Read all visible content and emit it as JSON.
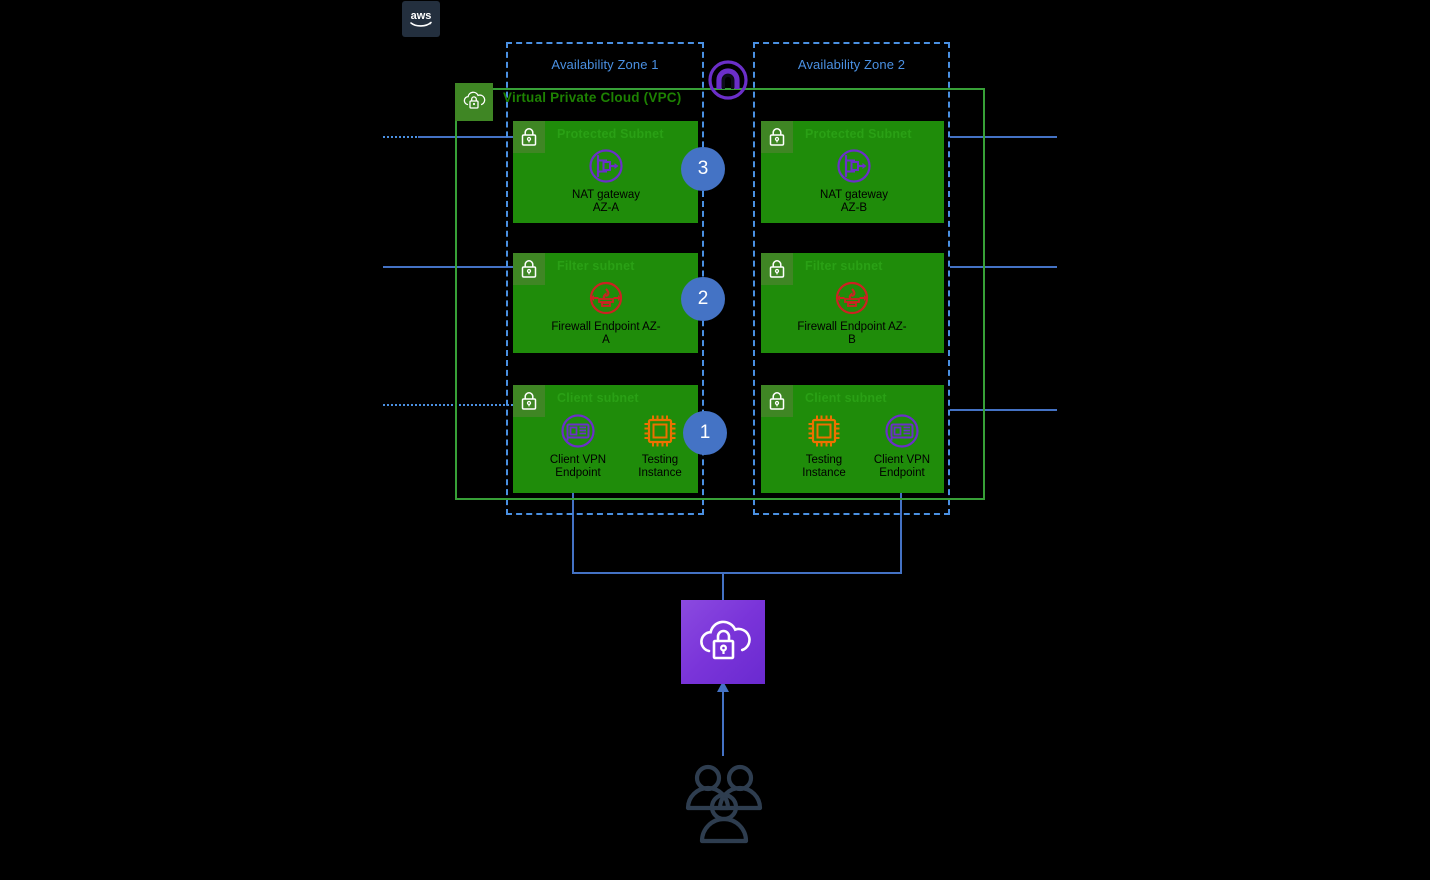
{
  "diagram": {
    "provider_logo": "aws-logo",
    "title_vpc": "Virtual Private Cloud (VPC)",
    "availability_zones": [
      {
        "label": "Availability Zone 1"
      },
      {
        "label": "Availability Zone 2"
      }
    ],
    "internet_gateway": {
      "icon": "internet-gateway-icon"
    },
    "subnets": [
      {
        "id": "protected-az-a",
        "label": "Protected Subnet",
        "zone": "Availability Zone 1",
        "resources": [
          {
            "name": "NAT gateway\nAZ-A",
            "icon": "nat-gateway-icon"
          }
        ]
      },
      {
        "id": "protected-az-b",
        "label": "Protected Subnet",
        "zone": "Availability Zone 2",
        "resources": [
          {
            "name": "NAT gateway\nAZ-B",
            "icon": "nat-gateway-icon"
          }
        ]
      },
      {
        "id": "filter-az-a",
        "label": "Filter subnet",
        "zone": "Availability Zone 1",
        "resources": [
          {
            "name": "Firewall Endpoint AZ-A",
            "icon": "network-firewall-icon"
          }
        ]
      },
      {
        "id": "filter-az-b",
        "label": "Filter subnet",
        "zone": "Availability Zone 2",
        "resources": [
          {
            "name": "Firewall Endpoint AZ-B",
            "icon": "network-firewall-icon"
          }
        ]
      },
      {
        "id": "client-az-a",
        "label": "Client subnet",
        "zone": "Availability Zone 1",
        "resources": [
          {
            "name": "Client VPN\nEndpoint",
            "icon": "client-vpn-endpoint-icon"
          },
          {
            "name": "Testing\nInstance",
            "icon": "ec2-instance-icon"
          }
        ]
      },
      {
        "id": "client-az-b",
        "label": "Client subnet",
        "zone": "Availability Zone 2",
        "resources": [
          {
            "name": "Testing\nInstance",
            "icon": "ec2-instance-icon"
          },
          {
            "name": "Client VPN\nEndpoint",
            "icon": "client-vpn-endpoint-icon"
          }
        ]
      }
    ],
    "steps": [
      {
        "number": "1"
      },
      {
        "number": "2"
      },
      {
        "number": "3"
      }
    ],
    "client_vpn_service": {
      "icon": "client-vpn-cloud-lock-icon"
    },
    "users": {
      "icon": "users-icon"
    },
    "colors": {
      "subnet_green": "#1f8c0a",
      "vpc_border_green": "#37a037",
      "az_dashed_blue": "#4a90e2",
      "step_blue": "#4473c5",
      "firewall_red": "#cc2222",
      "purple": "#7a34d9",
      "instance_orange": "#ed7100",
      "aws_navy": "#232f3e"
    }
  }
}
